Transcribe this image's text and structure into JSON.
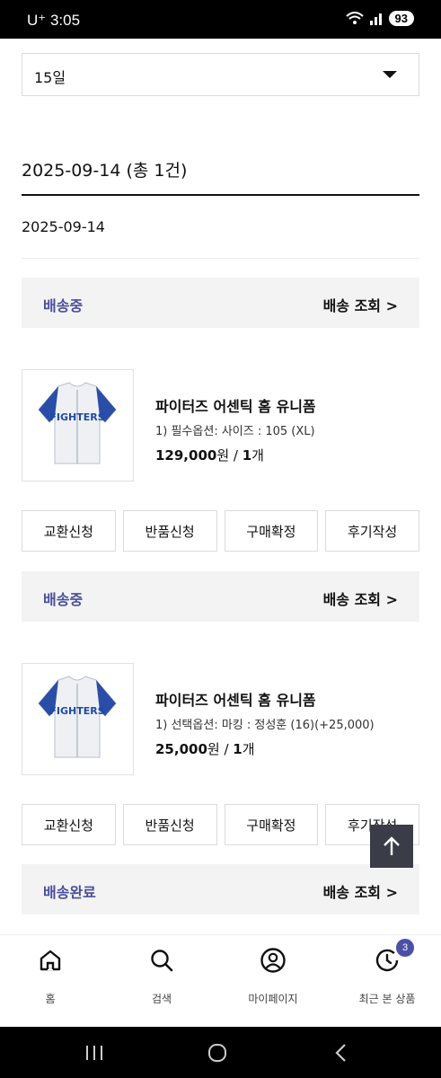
{
  "status_bar": {
    "carrier_time": "U⁺ 3:05",
    "battery": "93"
  },
  "filter": {
    "selected": "15일"
  },
  "order": {
    "heading": "2025-09-14 (총 1건)",
    "date": "2025-09-14"
  },
  "groups": [
    {
      "status": "배송중",
      "track_label": "배송 조회 >",
      "product": {
        "name": "파이터즈 어센틱 홈 유니폼",
        "option": "1) 필수옵션: 사이즈 : 105 (XL)",
        "price": "129,000",
        "price_unit": "원 / ",
        "qty": "1",
        "qty_unit": "개",
        "image": "fighters-home-jersey"
      },
      "actions": [
        "교환신청",
        "반품신청",
        "구매확정",
        "후기작성"
      ]
    },
    {
      "status": "배송중",
      "track_label": "배송 조회 >",
      "product": {
        "name": "파이터즈 어센틱 홈 유니폼",
        "option": "1) 선택옵션: 마킹 : 정성훈 (16)(+25,000)",
        "price": "25,000",
        "price_unit": "원 / ",
        "qty": "1",
        "qty_unit": "개",
        "image": "fighters-home-jersey"
      },
      "actions": [
        "교환신청",
        "반품신청",
        "구매확정",
        "후기작성"
      ]
    },
    {
      "status": "배송완료",
      "track_label": "배송 조회 >"
    }
  ],
  "jersey_text": "FIGHTERS",
  "bottom_nav": [
    {
      "label": "홈",
      "icon": "home-icon"
    },
    {
      "label": "검색",
      "icon": "search-icon"
    },
    {
      "label": "마이페이지",
      "icon": "user-icon"
    },
    {
      "label": "최근 본 상품",
      "icon": "history-icon",
      "badge": "3"
    }
  ],
  "colors": {
    "accent": "#4a4f9a",
    "status_bg": "#f3f3f4",
    "badge": "#4b4fa8"
  }
}
